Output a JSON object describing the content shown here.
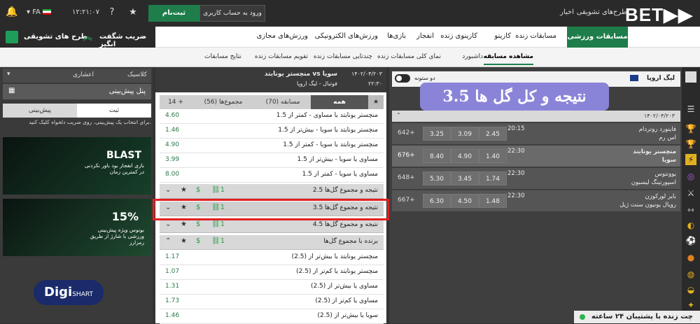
{
  "topbar": {
    "logo": "BET▶▶",
    "links": [
      "اخبار",
      "طرح‌های تشویقی"
    ],
    "login_label": "ورود به حساب کاربری",
    "register_label": "ثبت‌نام",
    "clock": "۱۲:۲۱:۰۷",
    "language": "FA"
  },
  "mainnav": {
    "active": "مسابقات ورزشی",
    "items": [
      "مسابقات زنده",
      "کازینو",
      "کازینوی زنده",
      "انفجار",
      "بازی‌ها",
      "ورزش‌های الکترونیکی",
      "ورزش‌های مجازی"
    ]
  },
  "promo": {
    "schemes": "طرح های تشویقی",
    "multiplier": "ضریب شگفت انگیز"
  },
  "subnav": {
    "items": [
      "مشاهده مسابقه",
      "داشبورد",
      "نمای کلی مسابقات زنده",
      "چندتایی مسابقات زنده",
      "تقویم مسابقات زنده",
      "نتایج مسابقات"
    ]
  },
  "left": {
    "odds_format": "کلاسیک",
    "odds_type": "اعشاری",
    "panel_title": "پنل پیش‌بینی",
    "tab_active": "ثبت",
    "tab_other": "پیش‌بینی",
    "hint": "برای انتخاب یک پیش‌بینی، روی ضریب دلخواه کلیک کنید.",
    "banner1_title": "BLAST",
    "banner1_text": "بازی انفجار بود باور نکردنی در کمترین زمان",
    "banner2_title": "15%",
    "banner2_text": "بونوس ویژه پیش‌بینی ورزشی با شارژ از طریق رمزارز",
    "digi": "Digi",
    "digi2": "SHART"
  },
  "middle": {
    "match_title": "منچستر یونایتد vs سویا",
    "match_date": "۱۴۰۲/۰۴/۲۰۳",
    "match_time": "۲۲:۳۰",
    "match_league": "فوتبال - لیگ اروپا",
    "tabs": [
      "همه",
      "مسابقه (70)",
      "مجموع‌ها (56)",
      "14 +"
    ],
    "rows": [
      {
        "label": "منچستر یونایتد یا مساوی - کمتر از 1.5",
        "odd": "4.60"
      },
      {
        "label": "منچستر یونایتد یا سویا - بیش‌تر از 1.5",
        "odd": "1.46"
      },
      {
        "label": "منچستر یونایتد یا سویا - کمتر از 1.5",
        "odd": "4.90"
      },
      {
        "label": "مساوی یا سویا - بیش‌تر از 1.5",
        "odd": "3.99"
      },
      {
        "label": "مساوی یا سویا - کمتر از 1.5",
        "odd": "8.00"
      }
    ],
    "group1": "نتیجه و مجموع گل‌ها 2.5",
    "group_highlight": "نتیجه و مجموع گل‌ها 3.5",
    "group3": "نتیجه و مجموع گل‌ها 4.5",
    "group4": "برنده با مجموع گل‌ها",
    "rows2": [
      {
        "label": "منچستر یونایتد یا بیش‌تر از (2.5)",
        "odd": "1.17"
      },
      {
        "label": "منچستر یونایتد یا کم‌تر از (2.5)",
        "odd": "1.07"
      },
      {
        "label": "مساوی یا بیش‌تر از (2.5)",
        "odd": "1.31"
      },
      {
        "label": "مساوی یا کم‌تر از (2.5)",
        "odd": "1.73"
      },
      {
        "label": "سویا یا بیش‌تر از (2.5)",
        "odd": "1.46"
      }
    ]
  },
  "right": {
    "league": "لیگ اروپا",
    "toggle_label": "دو ستونه",
    "date": "۱۴۰۲/۰۴/۲۰۳",
    "matches": [
      {
        "home": "فاینورد روتردام",
        "away": "اس رم",
        "time": "20:15",
        "o1": "2.45",
        "ox": "3.09",
        "o2": "3.25",
        "more": "642+"
      },
      {
        "home": "منچستر یونایتد",
        "away": "سویا",
        "time": "22:30",
        "o1": "1.40",
        "ox": "4.90",
        "o2": "8.40",
        "more": "676+"
      },
      {
        "home": "یوونتوس",
        "away": "اسپورتینگ لیسبون",
        "time": "22:30",
        "o1": "1.74",
        "ox": "3.45",
        "o2": "5.30",
        "more": "648+"
      },
      {
        "home": "بایر لورکوزن",
        "away": "رویال یونیون سنت ژیل",
        "time": "22:30",
        "o1": "1.48",
        "ox": "4.50",
        "o2": "6.30",
        "more": "667+"
      }
    ]
  },
  "overlay_title": "نتیجه و کل گل ها 3.5",
  "chat_label": "چت زنده با پشتیبان ۲۴ ساعته",
  "colors": {
    "accent": "#1e7d4a",
    "highlight": "#e02020",
    "overlay": "#8a84d8"
  }
}
